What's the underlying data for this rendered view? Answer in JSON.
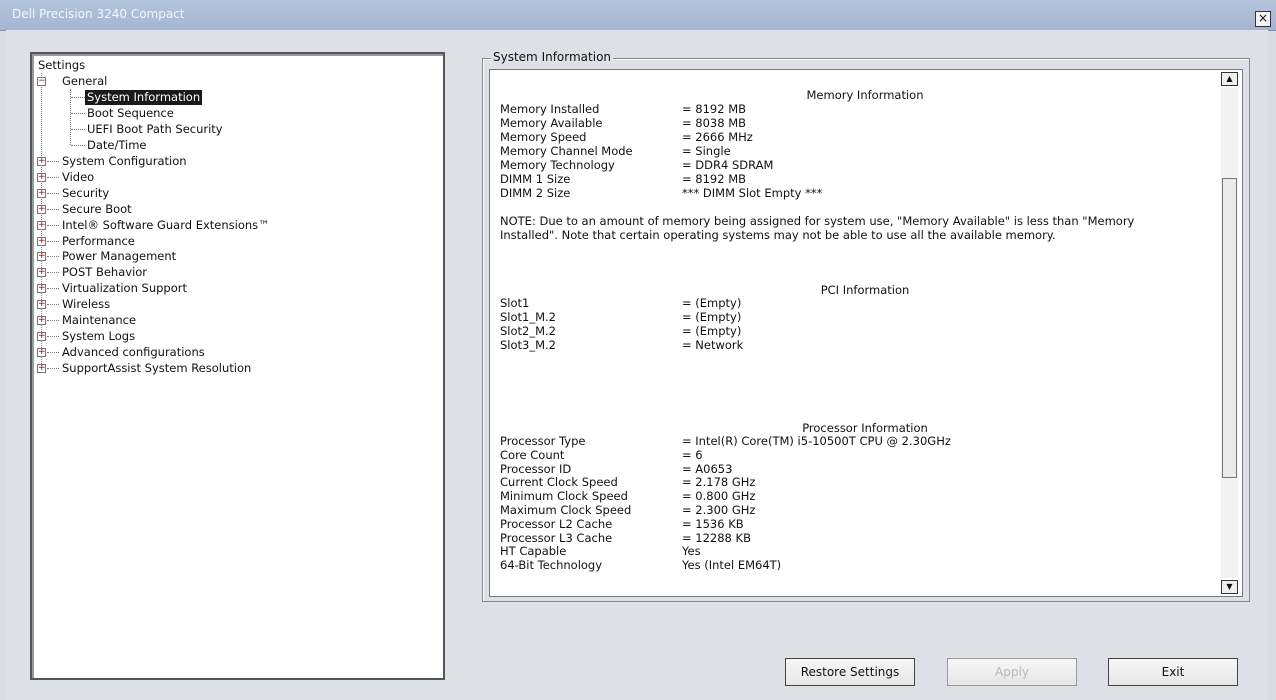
{
  "window": {
    "title": "Dell Precision 3240 Compact",
    "close_label": "×"
  },
  "tree": {
    "root": "Settings",
    "general": "General",
    "general_children": [
      "System Information",
      "Boot Sequence",
      "UEFI Boot Path Security",
      "Date/Time"
    ],
    "categories": [
      "System Configuration",
      "Video",
      "Security",
      "Secure Boot",
      "Intel® Software Guard Extensions™",
      "Performance",
      "Power Management",
      "POST Behavior",
      "Virtualization Support",
      "Wireless",
      "Maintenance",
      "System Logs",
      "Advanced configurations",
      "SupportAssist System Resolution"
    ],
    "expander_plus": "+",
    "expander_minus": "−"
  },
  "panel": {
    "title": "System Information",
    "memory": {
      "heading": "Memory Information",
      "rows": [
        {
          "k": "Memory Installed",
          "v": "= 8192 MB"
        },
        {
          "k": "Memory Available",
          "v": "= 8038 MB"
        },
        {
          "k": "Memory Speed",
          "v": "= 2666 MHz"
        },
        {
          "k": "Memory Channel Mode",
          "v": "= Single"
        },
        {
          "k": "Memory Technology",
          "v": "= DDR4 SDRAM"
        },
        {
          "k": "DIMM 1 Size",
          "v": "= 8192 MB"
        },
        {
          "k": "DIMM 2 Size",
          "v": "*** DIMM Slot Empty ***"
        }
      ],
      "note": "NOTE: Due to an amount of memory being assigned for system use, \"Memory Available\" is less than \"Memory Installed\". Note that certain operating systems may not be able to use all the available memory."
    },
    "pci": {
      "heading": "PCI Information",
      "rows": [
        {
          "k": "Slot1",
          "v": "= (Empty)"
        },
        {
          "k": "Slot1_M.2",
          "v": "= (Empty)"
        },
        {
          "k": "Slot2_M.2",
          "v": "= (Empty)"
        },
        {
          "k": "Slot3_M.2",
          "v": "= Network"
        }
      ]
    },
    "processor": {
      "heading": "Processor Information",
      "rows": [
        {
          "k": "Processor Type",
          "v": "= Intel(R) Core(TM) i5-10500T CPU @ 2.30GHz"
        },
        {
          "k": "Core Count",
          "v": "= 6"
        },
        {
          "k": "Processor ID",
          "v": "= A0653"
        },
        {
          "k": "Current Clock Speed",
          "v": "= 2.178 GHz"
        },
        {
          "k": "Minimum Clock Speed",
          "v": "= 0.800 GHz"
        },
        {
          "k": "Maximum Clock Speed",
          "v": "= 2.300 GHz"
        },
        {
          "k": "Processor L2 Cache",
          "v": "= 1536 KB"
        },
        {
          "k": "Processor L3 Cache",
          "v": "= 12288 KB"
        },
        {
          "k": "HT Capable",
          "v": "Yes"
        },
        {
          "k": "64-Bit Technology",
          "v": "Yes (Intel EM64T)"
        }
      ]
    }
  },
  "scrollbar": {
    "up": "▲",
    "down": "▼"
  },
  "buttons": {
    "restore": "Restore Settings",
    "apply": "Apply",
    "exit": "Exit"
  }
}
